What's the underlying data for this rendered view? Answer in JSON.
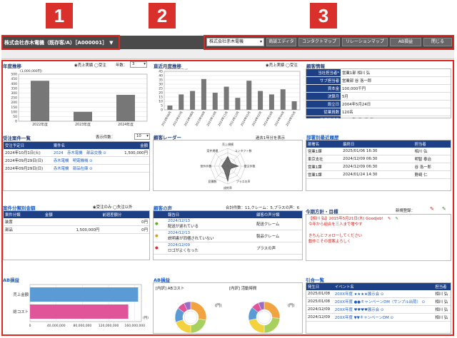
{
  "callouts": [
    "1",
    "2",
    "3"
  ],
  "topbar": {
    "company": "株式会社赤木電機（既存客/A）［A000001］",
    "selector": "株式会社赤木電機",
    "buttons": [
      "商談エディタ",
      "コンタクトマップ",
      "リレーションマップ",
      "AB損益",
      "閉じる"
    ]
  },
  "nendo": {
    "title": "年度推移",
    "radio": "◉売上実績 ◯受注",
    "year_label": "年数：",
    "year_value": "3",
    "unit": "(1,000,000円)",
    "chart_data": {
      "type": "bar",
      "categories": [
        "2022年度",
        "2023年度",
        "2024年度"
      ],
      "values": [
        430,
        100,
        280
      ],
      "yticks": [
        "500",
        "450",
        "400",
        "350",
        "300",
        "250",
        "200",
        "150",
        "100",
        "50",
        "0"
      ],
      "ylim": [
        0,
        500
      ],
      "unit": "(1,000,000円)",
      "grid": true
    }
  },
  "weekly": {
    "title": "直近月度推移",
    "radio": "◉売上実績 ◯受注",
    "unit": "(1,000,000円)",
    "chart_data": {
      "type": "bar",
      "categories": [
        "2023年06月",
        "2023年07月",
        "2023年08月",
        "2023年09月",
        "2023年10月",
        "2023年11月",
        "2023年12月",
        "2024年01月",
        "2024年02月",
        "2024年03月",
        "2024年04月",
        "2024年05月"
      ],
      "values": [
        5,
        18,
        22,
        36,
        20,
        27,
        14,
        34,
        22,
        18,
        24,
        10
      ],
      "yticks": [
        "45",
        "40",
        "35",
        "30",
        "25",
        "20",
        "15",
        "10",
        "5",
        "0"
      ],
      "ylim": [
        0,
        45
      ],
      "unit": "(1,000,000円)",
      "grid": true
    }
  },
  "customer": {
    "title": "顧客情報",
    "rows": [
      {
        "k": "当社担当者*",
        "v": "営業1部 相川 弘"
      },
      {
        "k": "サブ担当者",
        "v": "営業部 谷 洛一郎"
      },
      {
        "k": "資本金",
        "v": "100,000千円"
      },
      {
        "k": "決算月",
        "v": "5月"
      },
      {
        "k": "設立日",
        "v": "2004年5月24日"
      },
      {
        "k": "従業員数",
        "v": "120名"
      },
      {
        "k": "口座開設日",
        "v": "2005年5月2日(月)"
      }
    ]
  },
  "orders": {
    "title": "受注案件一覧",
    "count_label": "表示件数：",
    "count_value": "10",
    "headers": [
      "受注予定日",
      "案件名",
      "金額"
    ],
    "rows": [
      {
        "date": "2024年10月1日(火)",
        "name": "2024　赤木電機　部品交換",
        "amount": "1,500,000円"
      },
      {
        "date": "2024年09月29日(日)",
        "name": "赤木電機　明電機械",
        "amount": ""
      },
      {
        "date": "2024年09月29日(日)",
        "name": "赤木電機　部品在庫",
        "amount": ""
      }
    ]
  },
  "radar": {
    "title": "顧客レーダー",
    "period": "過去1年分を表示",
    "axes": [
      "売上規模",
      "コンタクト数",
      "受注件数",
      "プラスの声",
      "成約率",
      "見積数",
      "案件件数",
      "案件規模"
    ],
    "values": [
      0.55,
      0.25,
      0.6,
      0.2,
      0.85,
      0.3,
      0.35,
      0.3
    ]
  },
  "history": {
    "title": "部署別最近履歴",
    "headers": [
      "部署名",
      "最終日",
      "担当者"
    ],
    "rows": [
      {
        "dept": "営業1課",
        "date": "2025/01/06 16:30",
        "person": "相川 弘"
      },
      {
        "dept": "東京支社",
        "date": "2024/12/09 06:30",
        "person": "明智 泰治"
      },
      {
        "dept": "営業1課",
        "date": "2024/12/09 06:30",
        "person": "谷 洛一郎"
      },
      {
        "dept": "営業1課",
        "date": "2024/01/24 14:30",
        "person": "野崎 仁"
      }
    ]
  },
  "category": {
    "title": "案件分類別金額",
    "radio": "◉受注のみ ◯失注以外",
    "headers": [
      "案件分類",
      "金額",
      "前週差額分"
    ],
    "rows": [
      {
        "cat": "装置",
        "amount": "",
        "diff": "0円"
      },
      {
        "cat": "部品",
        "amount": "1,500,000円",
        "diff": "0円"
      }
    ]
  },
  "voice": {
    "title": "顧客の声",
    "summary": "合計件数：11,クレーム：5,プラスの声：6",
    "headers": [
      "報告日",
      "顧客の声分類"
    ],
    "rows": [
      {
        "date": "2024/12/13",
        "text": "配送が遅れている",
        "cls": "配送クレーム"
      },
      {
        "date": "2024/12/13",
        "text": "説明書が同梱されていない",
        "cls": "製品クレーム"
      },
      {
        "date": "2024/12/09",
        "text": "ロゴがよくなった",
        "cls": "プラスの声"
      }
    ]
  },
  "memo": {
    "title": "今期方針・目標",
    "new_label": "新規登録：",
    "lines": [
      "【相川 弘】2015年5月21日(木) GoodJob!",
      "今年から組合を三人まで増やす",
      "",
      "きちんとフォローしてください",
      "動作こその提案よろしく"
    ]
  },
  "ab": {
    "title": "AB損益",
    "unit": "(円)",
    "chart_data": {
      "type": "bar",
      "orientation": "horizontal",
      "categories": [
        "売上金額",
        "総コスト"
      ],
      "values": [
        165000000,
        150000000
      ],
      "xticks": [
        "0",
        "40,000,000",
        "80,000,000",
        "120,000,000",
        "160,000,000"
      ],
      "xlim": [
        0,
        170000000
      ],
      "unit": "(円)",
      "colors": [
        "#5b9bd5",
        "#e0559a"
      ]
    }
  },
  "abdetail": {
    "title": "AB損益",
    "label1": "[内訳] ABコスト",
    "label2": "[内訳] 活動時間",
    "unit": "(円)",
    "chart_data": [
      {
        "type": "pie",
        "name": "[内訳] ABコスト",
        "slices": [
          28,
          22,
          20,
          15,
          8,
          7
        ],
        "colors": [
          "#f2a341",
          "#a8d05c",
          "#f2d23e",
          "#5b9bd5",
          "#e0559a",
          "#9b6cc6"
        ]
      },
      {
        "type": "pie",
        "name": "[内訳] 活動時間",
        "slices": [
          26,
          24,
          22,
          14,
          8,
          6
        ],
        "colors": [
          "#f2a341",
          "#a8d05c",
          "#f2d23e",
          "#5b9bd5",
          "#e0559a",
          "#9b6cc6"
        ]
      }
    ]
  },
  "events": {
    "title": "引合一覧",
    "headers": [
      "発生日",
      "イベント名",
      "担当者"
    ],
    "rows": [
      {
        "date": "2025/01/08",
        "name": "20XX年度 ★★★★展示会",
        "person": "相川 弘"
      },
      {
        "date": "2025/01/08",
        "name": "20XX年度 ●●キャンペーンDM（サンプル出荷）",
        "person": "相川 弘"
      },
      {
        "date": "2024/12/09",
        "name": "20XX年度 ♥♥♥♥展示会",
        "person": "相川 弘"
      },
      {
        "date": "2024/12/09",
        "name": "20XX年度 ▼▼キャンペーンDM",
        "person": "相川 弘"
      }
    ]
  },
  "colors": {
    "accent": "#e0261d",
    "header": "#1c3f86",
    "bar": "#777777"
  }
}
